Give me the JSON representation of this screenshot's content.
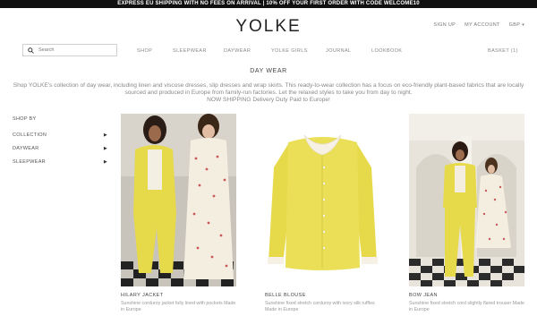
{
  "promo": "EXPRESS EU SHIPPING WITH NO FEES ON ARRIVAL | 10% OFF YOUR FIRST ORDER WITH CODE WELCOME10",
  "brand": "YOLKE",
  "util": {
    "sign_up": "SIGN UP",
    "account": "MY ACCOUNT",
    "currency": "GBP"
  },
  "search": {
    "placeholder": "Search"
  },
  "nav": {
    "shop": "SHOP",
    "sleepwear": "SLEEPWEAR",
    "daywear": "DAYWEAR",
    "girls": "YOLKE GIRLS",
    "journal": "JOURNAL",
    "lookbook": "LOOKBOOK",
    "basket": "BASKET (1)"
  },
  "page": {
    "title": "DAY WEAR",
    "intro": "Shop YOLKE's collection of day wear, including linen and viscose dresses, slip dresses and wrap skirts. This ready-to-wear collection has a focus on eco-friendly plant-based fabrics that are locally sourced and produced in Europe from family-run factories. Let the relaxed styles to take you from day to night.",
    "shipping": "NOW SHIPPING Delivery Duty Paid to Europe!"
  },
  "sidebar": {
    "heading": "SHOP BY",
    "items": [
      {
        "label": "COLLECTION"
      },
      {
        "label": "DAYWEAR"
      },
      {
        "label": "SLEEPWEAR"
      }
    ]
  },
  "products": [
    {
      "name": "HILARY JACKET",
      "desc": "Sunshine corduroy jacket fully lined with pockets Made in Europe"
    },
    {
      "name": "BELLE BLOUSE",
      "desc": "Sunshine fixed stretch corduroy with ivory silk ruffles Made in Europe"
    },
    {
      "name": "BOW JEAN",
      "desc": "Sunshine fixed stretch cord slightly flared trouser Made in Europe"
    }
  ],
  "colors": {
    "promo_bg": "#111111",
    "accent_yellow": "#e6d94a",
    "text_muted": "#888888"
  }
}
